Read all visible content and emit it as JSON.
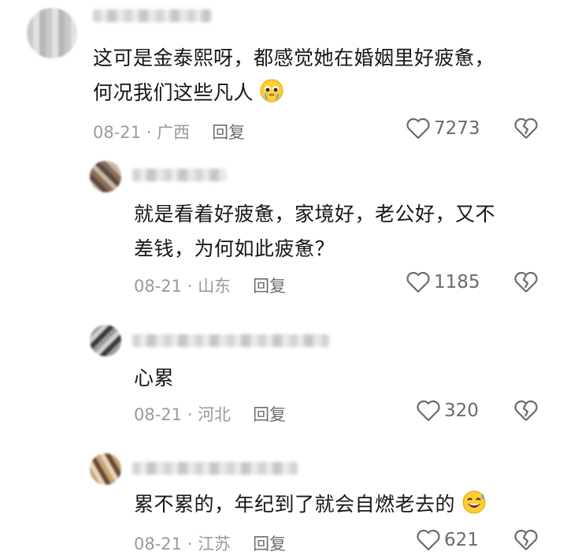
{
  "comments": [
    {
      "text_lines": [
        "这可是金泰熙呀，都感觉她在婚姻里好疲惫，",
        "何况我们这些凡人"
      ],
      "emoji": "pleading-face-emoji",
      "date": "08-21",
      "location": "广西",
      "reply_label": "回复",
      "likes": "7273"
    },
    {
      "text_lines": [
        "就是看着好疲惫，家境好，老公好，又不",
        "差钱，为何如此疲惫？"
      ],
      "date": "08-21",
      "location": "山东",
      "reply_label": "回复",
      "likes": "1185"
    },
    {
      "text_lines": [
        "心累"
      ],
      "date": "08-21",
      "location": "河北",
      "reply_label": "回复",
      "likes": "320"
    },
    {
      "text_lines": [
        "累不累的，年纪到了就会自燃老去的"
      ],
      "emoji": "sweat-smile-emoji",
      "date": "08-21",
      "location": "江苏",
      "reply_label": "回复",
      "likes": "621"
    }
  ],
  "separator": " · ",
  "colors": {
    "text": "#161616",
    "meta": "#9a9a9a",
    "icon": "#6a6a6a"
  }
}
